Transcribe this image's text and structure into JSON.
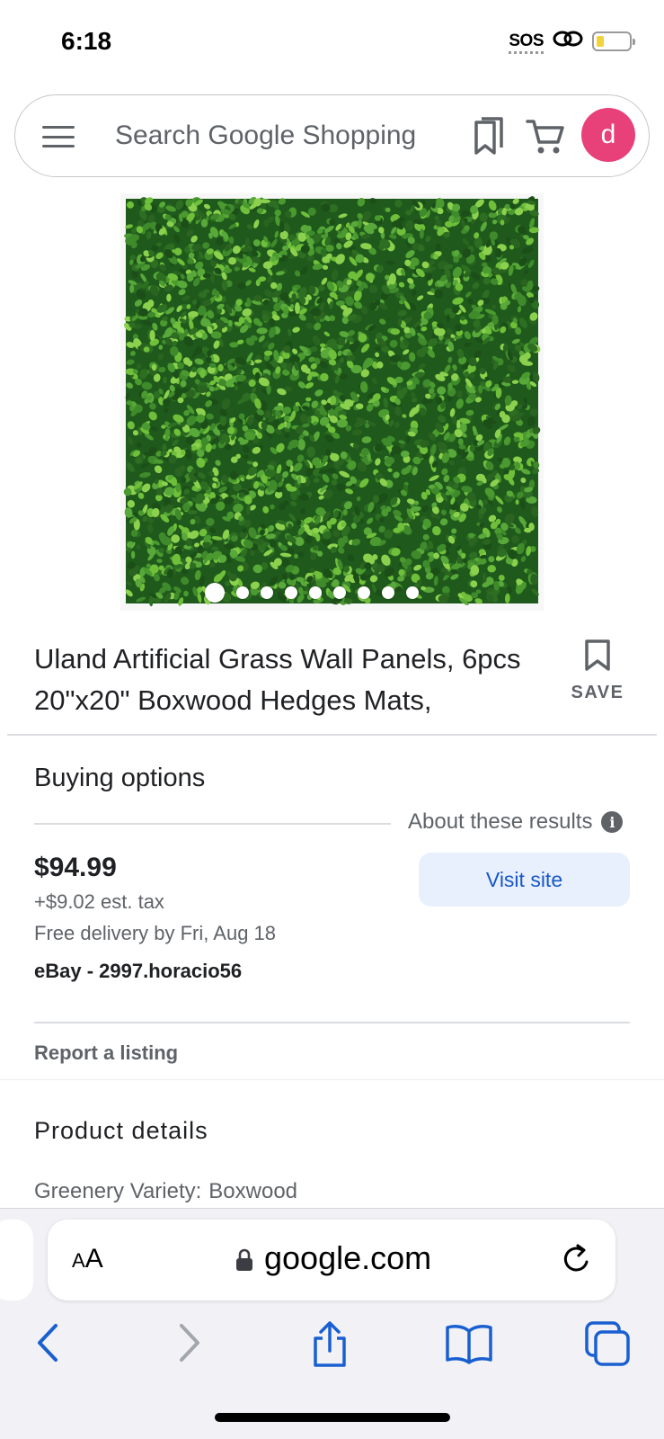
{
  "status_bar": {
    "time": "6:18",
    "sos": "SOS"
  },
  "search": {
    "placeholder": "Search Google Shopping",
    "avatar_letter": "d"
  },
  "product": {
    "image_pages": 9,
    "active_page": 1,
    "title": "Uland Artificial Grass Wall Panels, 6pcs 20\"x20\" Boxwood Hedges Mats,",
    "save_label": "SAVE"
  },
  "buying_options": {
    "heading": "Buying options",
    "about_label": "About these results",
    "price": "$94.99",
    "tax": "+$9.02 est. tax",
    "delivery": "Free delivery by Fri, Aug 18",
    "seller": "eBay - 2997.horacio56",
    "visit_label": "Visit site",
    "report_label": "Report a listing"
  },
  "product_details": {
    "heading": "Product details",
    "rows": [
      {
        "label": "Greenery Variety:",
        "value": "Boxwood"
      }
    ]
  },
  "browser": {
    "aa_label": "AA",
    "url": "google.com"
  },
  "colors": {
    "avatar": "#e8417a",
    "visit_button_bg": "#e8f0fe",
    "visit_button_text": "#1a57c7",
    "safari_blue": "#1a5fd0",
    "foliage_dark": "#1f5a1c",
    "foliage_light": "#6fbf3a"
  }
}
